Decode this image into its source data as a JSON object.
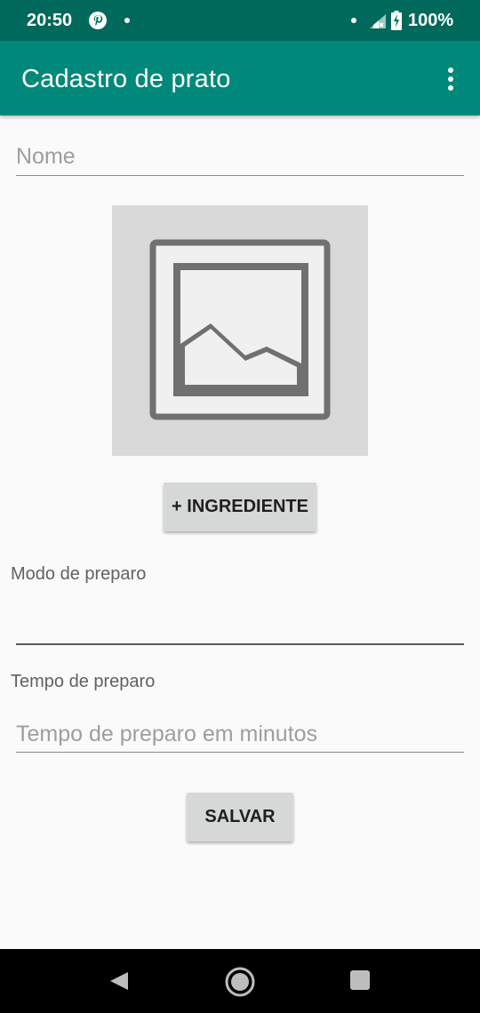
{
  "status_bar": {
    "time": "20:50",
    "battery_percent": "100%",
    "icons": [
      "pinterest-icon",
      "notification-dot-icon",
      "signal-icon",
      "battery-charging-icon"
    ]
  },
  "app_bar": {
    "title": "Cadastro de prato",
    "menu_icon": "more-vert-icon"
  },
  "form": {
    "nome": {
      "value": "",
      "placeholder": "Nome"
    },
    "image_placeholder_icon": "image-icon",
    "add_ingredient_label": "+ INGREDIENTE",
    "modo_preparo": {
      "label": "Modo de preparo",
      "value": ""
    },
    "tempo_preparo": {
      "label": "Tempo de preparo",
      "value": "",
      "placeholder": "Tempo de preparo em minutos"
    },
    "save_label": "SALVAR"
  },
  "nav_bar": {
    "icons": [
      "back-icon",
      "home-icon",
      "recents-icon"
    ]
  },
  "colors": {
    "status_bar": "#00695c",
    "app_bar": "#00897b",
    "background": "#fafafa",
    "button": "#d6d7d7",
    "image_placeholder": "#d8d9d8"
  }
}
